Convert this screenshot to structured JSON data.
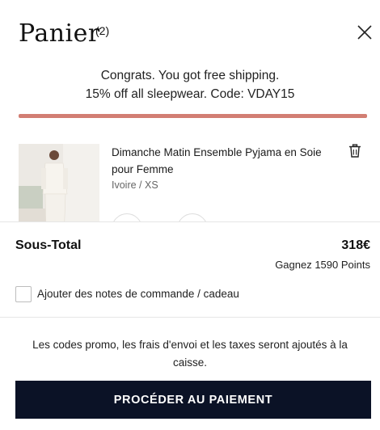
{
  "cart": {
    "title": "Panier",
    "count": "(2)",
    "banner_line1": "Congrats. You got free shipping.",
    "banner_line2": "15% off all sleepwear. Code: VDAY15",
    "progress_fraction": 1.0,
    "accent_color": "#d27e73",
    "icons": {
      "close": "close-icon",
      "delete": "trash-icon"
    }
  },
  "items": [
    {
      "name": "Dimanche Matin Ensemble Pyjama en Soie pour Femme",
      "variant": "Ivoire / XS"
    }
  ],
  "summary": {
    "subtotal_label": "Sous-Total",
    "subtotal_value": "318€",
    "points": "Gagnez 1590 Points"
  },
  "notes": {
    "label": "Ajouter des notes de commande / cadeau"
  },
  "footer": {
    "disclaimer": "Les codes promo, les frais d'envoi et les taxes seront ajoutés à la caisse.",
    "checkout_label": "Procéder au paiement",
    "checkout_color": "#0b1226"
  }
}
